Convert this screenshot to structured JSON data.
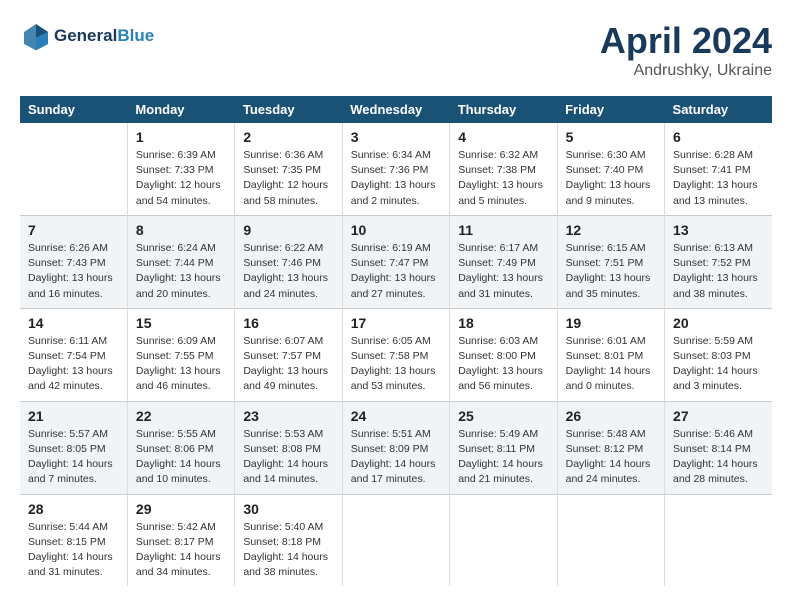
{
  "header": {
    "logo_line1": "General",
    "logo_line2": "Blue",
    "month": "April 2024",
    "location": "Andrushky, Ukraine"
  },
  "days_of_week": [
    "Sunday",
    "Monday",
    "Tuesday",
    "Wednesday",
    "Thursday",
    "Friday",
    "Saturday"
  ],
  "weeks": [
    [
      {
        "day": "",
        "info": ""
      },
      {
        "day": "1",
        "info": "Sunrise: 6:39 AM\nSunset: 7:33 PM\nDaylight: 12 hours\nand 54 minutes."
      },
      {
        "day": "2",
        "info": "Sunrise: 6:36 AM\nSunset: 7:35 PM\nDaylight: 12 hours\nand 58 minutes."
      },
      {
        "day": "3",
        "info": "Sunrise: 6:34 AM\nSunset: 7:36 PM\nDaylight: 13 hours\nand 2 minutes."
      },
      {
        "day": "4",
        "info": "Sunrise: 6:32 AM\nSunset: 7:38 PM\nDaylight: 13 hours\nand 5 minutes."
      },
      {
        "day": "5",
        "info": "Sunrise: 6:30 AM\nSunset: 7:40 PM\nDaylight: 13 hours\nand 9 minutes."
      },
      {
        "day": "6",
        "info": "Sunrise: 6:28 AM\nSunset: 7:41 PM\nDaylight: 13 hours\nand 13 minutes."
      }
    ],
    [
      {
        "day": "7",
        "info": "Sunrise: 6:26 AM\nSunset: 7:43 PM\nDaylight: 13 hours\nand 16 minutes."
      },
      {
        "day": "8",
        "info": "Sunrise: 6:24 AM\nSunset: 7:44 PM\nDaylight: 13 hours\nand 20 minutes."
      },
      {
        "day": "9",
        "info": "Sunrise: 6:22 AM\nSunset: 7:46 PM\nDaylight: 13 hours\nand 24 minutes."
      },
      {
        "day": "10",
        "info": "Sunrise: 6:19 AM\nSunset: 7:47 PM\nDaylight: 13 hours\nand 27 minutes."
      },
      {
        "day": "11",
        "info": "Sunrise: 6:17 AM\nSunset: 7:49 PM\nDaylight: 13 hours\nand 31 minutes."
      },
      {
        "day": "12",
        "info": "Sunrise: 6:15 AM\nSunset: 7:51 PM\nDaylight: 13 hours\nand 35 minutes."
      },
      {
        "day": "13",
        "info": "Sunrise: 6:13 AM\nSunset: 7:52 PM\nDaylight: 13 hours\nand 38 minutes."
      }
    ],
    [
      {
        "day": "14",
        "info": "Sunrise: 6:11 AM\nSunset: 7:54 PM\nDaylight: 13 hours\nand 42 minutes."
      },
      {
        "day": "15",
        "info": "Sunrise: 6:09 AM\nSunset: 7:55 PM\nDaylight: 13 hours\nand 46 minutes."
      },
      {
        "day": "16",
        "info": "Sunrise: 6:07 AM\nSunset: 7:57 PM\nDaylight: 13 hours\nand 49 minutes."
      },
      {
        "day": "17",
        "info": "Sunrise: 6:05 AM\nSunset: 7:58 PM\nDaylight: 13 hours\nand 53 minutes."
      },
      {
        "day": "18",
        "info": "Sunrise: 6:03 AM\nSunset: 8:00 PM\nDaylight: 13 hours\nand 56 minutes."
      },
      {
        "day": "19",
        "info": "Sunrise: 6:01 AM\nSunset: 8:01 PM\nDaylight: 14 hours\nand 0 minutes."
      },
      {
        "day": "20",
        "info": "Sunrise: 5:59 AM\nSunset: 8:03 PM\nDaylight: 14 hours\nand 3 minutes."
      }
    ],
    [
      {
        "day": "21",
        "info": "Sunrise: 5:57 AM\nSunset: 8:05 PM\nDaylight: 14 hours\nand 7 minutes."
      },
      {
        "day": "22",
        "info": "Sunrise: 5:55 AM\nSunset: 8:06 PM\nDaylight: 14 hours\nand 10 minutes."
      },
      {
        "day": "23",
        "info": "Sunrise: 5:53 AM\nSunset: 8:08 PM\nDaylight: 14 hours\nand 14 minutes."
      },
      {
        "day": "24",
        "info": "Sunrise: 5:51 AM\nSunset: 8:09 PM\nDaylight: 14 hours\nand 17 minutes."
      },
      {
        "day": "25",
        "info": "Sunrise: 5:49 AM\nSunset: 8:11 PM\nDaylight: 14 hours\nand 21 minutes."
      },
      {
        "day": "26",
        "info": "Sunrise: 5:48 AM\nSunset: 8:12 PM\nDaylight: 14 hours\nand 24 minutes."
      },
      {
        "day": "27",
        "info": "Sunrise: 5:46 AM\nSunset: 8:14 PM\nDaylight: 14 hours\nand 28 minutes."
      }
    ],
    [
      {
        "day": "28",
        "info": "Sunrise: 5:44 AM\nSunset: 8:15 PM\nDaylight: 14 hours\nand 31 minutes."
      },
      {
        "day": "29",
        "info": "Sunrise: 5:42 AM\nSunset: 8:17 PM\nDaylight: 14 hours\nand 34 minutes."
      },
      {
        "day": "30",
        "info": "Sunrise: 5:40 AM\nSunset: 8:18 PM\nDaylight: 14 hours\nand 38 minutes."
      },
      {
        "day": "",
        "info": ""
      },
      {
        "day": "",
        "info": ""
      },
      {
        "day": "",
        "info": ""
      },
      {
        "day": "",
        "info": ""
      }
    ]
  ]
}
